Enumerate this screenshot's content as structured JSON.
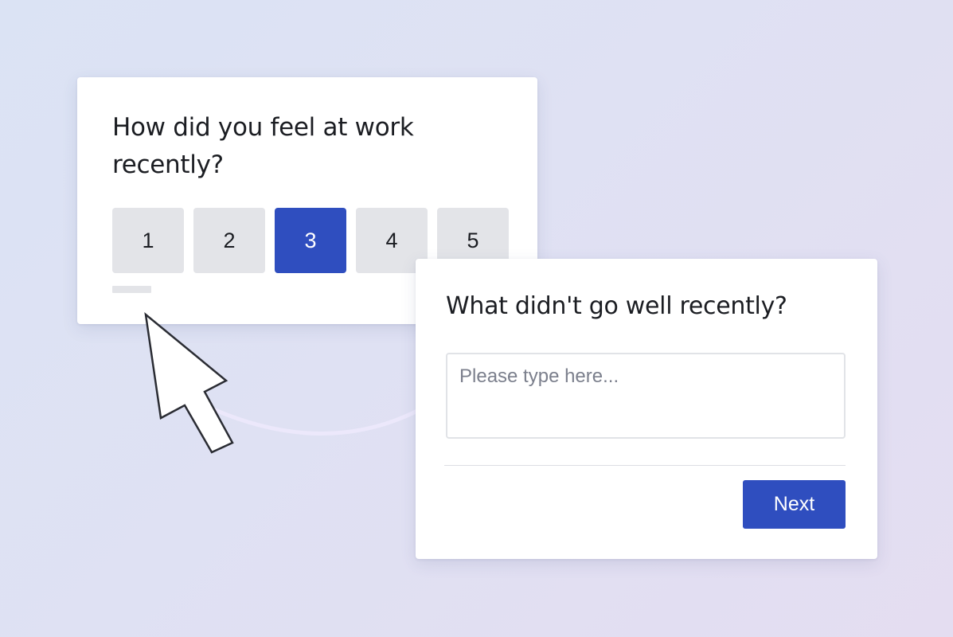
{
  "rating_card": {
    "question": "How did you feel at work recently?",
    "options": [
      "1",
      "2",
      "3",
      "4",
      "5"
    ],
    "selected_value": "3"
  },
  "feedback_card": {
    "question": "What didn't go well recently?",
    "input_placeholder": "Please type here...",
    "input_value": "",
    "next_label": "Next"
  },
  "colors": {
    "accent": "#2f4ebf",
    "option_background": "#e3e4e8",
    "text": "#1b1d22",
    "connector": "#ece8fb"
  },
  "icons": [
    "mouse-pointer-icon"
  ]
}
